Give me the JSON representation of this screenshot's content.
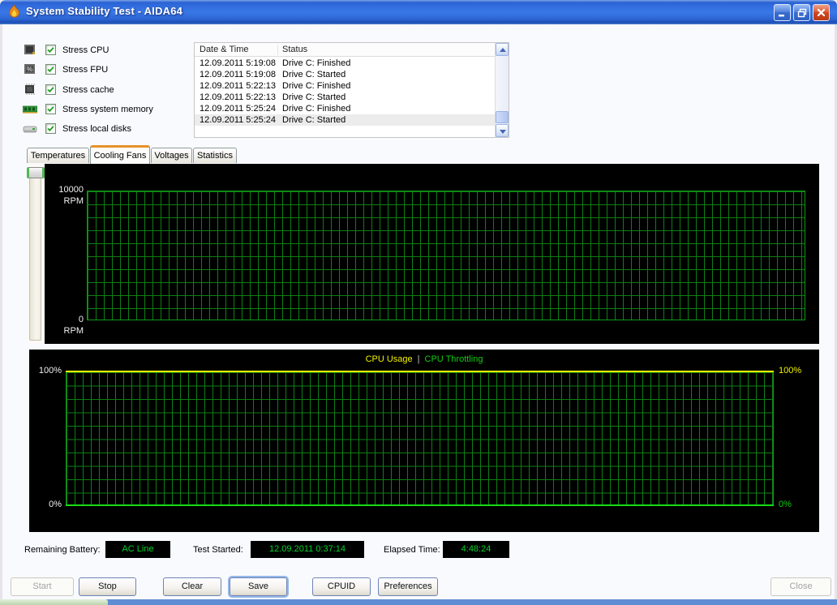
{
  "window": {
    "title": "System Stability Test - AIDA64"
  },
  "stress_options": [
    {
      "label": "Stress CPU",
      "icon": "cpu-icon",
      "checked": true
    },
    {
      "label": "Stress FPU",
      "icon": "fpu-icon",
      "checked": true
    },
    {
      "label": "Stress cache",
      "icon": "cache-icon",
      "checked": true
    },
    {
      "label": "Stress system memory",
      "icon": "memory-icon",
      "checked": true
    },
    {
      "label": "Stress local disks",
      "icon": "disk-icon",
      "checked": true
    }
  ],
  "log": {
    "columns": [
      "Date & Time",
      "Status"
    ],
    "rows": [
      [
        "12.09.2011 5:19:08",
        "Drive C: Finished"
      ],
      [
        "12.09.2011 5:19:08",
        "Drive C: Started"
      ],
      [
        "12.09.2011 5:22:13",
        "Drive C: Finished"
      ],
      [
        "12.09.2011 5:22:13",
        "Drive C: Started"
      ],
      [
        "12.09.2011 5:25:24",
        "Drive C: Finished"
      ],
      [
        "12.09.2011 5:25:24",
        "Drive C: Started"
      ]
    ],
    "selected_row_index": 5
  },
  "tabs": [
    {
      "label": "Temperatures",
      "active": false
    },
    {
      "label": "Cooling Fans",
      "active": true
    },
    {
      "label": "Voltages",
      "active": false
    },
    {
      "label": "Statistics",
      "active": false
    }
  ],
  "fan_chart": {
    "y_max": "10000",
    "y_min": "0",
    "y_unit": "RPM"
  },
  "cpu_chart": {
    "legend": {
      "usage": "CPU Usage",
      "separator": "|",
      "throttling": "CPU Throttling"
    },
    "left_top": "100%",
    "left_bottom": "0%",
    "right_top": "100%",
    "right_bottom": "0%",
    "usage_color": "#f2f200",
    "throttling_color": "#13ce13"
  },
  "chart_data": [
    {
      "type": "line",
      "title": "Cooling Fans",
      "ylabel": "RPM",
      "ylim": [
        0,
        10000
      ],
      "y_tick_labels": [
        "10000 RPM",
        "0 RPM"
      ],
      "grid": true,
      "series": []
    },
    {
      "type": "line",
      "title": "CPU Usage | CPU Throttling",
      "ylim": [
        0,
        100
      ],
      "y_tick_labels_left": [
        "100%",
        "0%"
      ],
      "y_tick_labels_right": [
        "100%",
        "0%"
      ],
      "grid": true,
      "legend_position": "top-center",
      "series": [
        {
          "name": "CPU Usage",
          "color": "#f2f200",
          "values": [
            100
          ],
          "current_value": "100%"
        },
        {
          "name": "CPU Throttling",
          "color": "#13ce13",
          "values": [
            0
          ],
          "current_value": "0%"
        }
      ]
    }
  ],
  "status_bar": {
    "battery_label": "Remaining Battery:",
    "battery_value": "AC Line",
    "started_label": "Test Started:",
    "started_value": "12.09.2011 0:37:14",
    "elapsed_label": "Elapsed Time:",
    "elapsed_value": "4:48:24",
    "value_color": "#00d42a"
  },
  "actions": [
    {
      "label": "Start",
      "enabled": false
    },
    {
      "label": "Stop",
      "enabled": true
    },
    {
      "label": "Clear",
      "enabled": true
    },
    {
      "label": "Save",
      "enabled": true,
      "default": true
    },
    {
      "label": "CPUID",
      "enabled": true
    },
    {
      "label": "Preferences",
      "enabled": true
    },
    {
      "label": "Close",
      "enabled": false
    }
  ]
}
